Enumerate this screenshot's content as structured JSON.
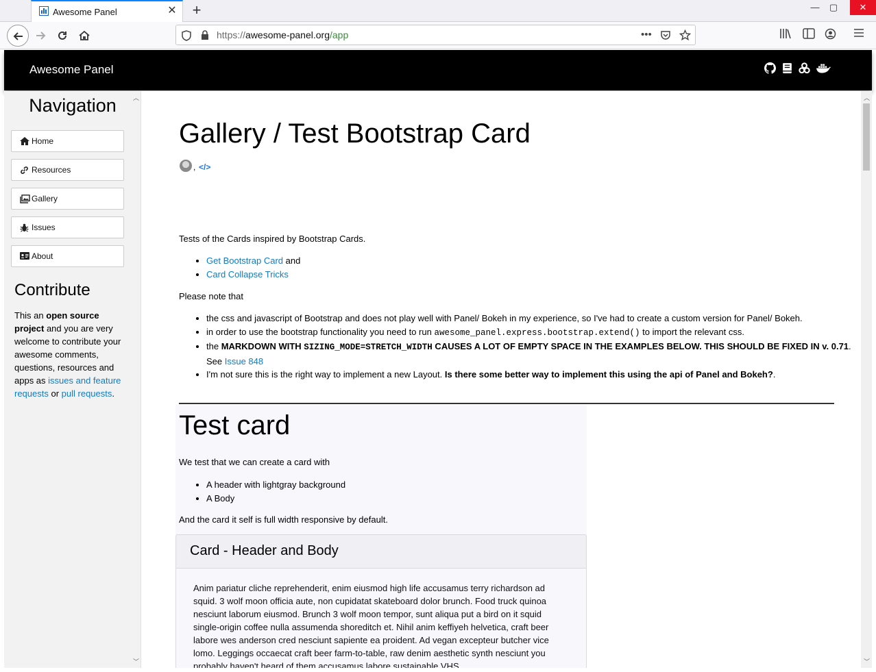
{
  "browser": {
    "tab_title": "Awesome Panel",
    "url_scheme": "https://",
    "url_host": "awesome-panel.org",
    "url_path": "/app"
  },
  "header": {
    "title": "Awesome Panel",
    "icons": [
      "github-icon",
      "book-icon",
      "binder-icon",
      "docker-icon"
    ]
  },
  "sidebar": {
    "heading": "Navigation",
    "items": [
      {
        "label": "Home",
        "icon": "home-icon"
      },
      {
        "label": "Resources",
        "icon": "link-icon"
      },
      {
        "label": "Gallery",
        "icon": "images-icon"
      },
      {
        "label": "Issues",
        "icon": "bug-icon"
      },
      {
        "label": "About",
        "icon": "id-card-icon"
      }
    ],
    "contribute": {
      "heading": "Contribute",
      "t1": "This an ",
      "t2": "open source project",
      "t3": " and you are very welcome to contribute your awesome comments, questions, resources and apps as ",
      "link1": "issues and feature requests",
      "t4": " or ",
      "link2": "pull requests",
      "t5": "."
    }
  },
  "main": {
    "title": "Gallery / Test Bootstrap Card",
    "intro": "Tests of the Cards inspired by Bootstrap Cards.",
    "links": {
      "get_card": "Get Bootstrap Card",
      "and": " and",
      "collapse": "Card Collapse Tricks"
    },
    "note_heading": "Please note that",
    "notes": {
      "n1": "the css and javascript of Bootstrap and does not play well with Panel/ Bokeh in my experience, so I've had to create a custom version for Panel/ Bokeh.",
      "n2a": "in order to use the bootstrap functionality you need to run ",
      "n2code": "awesome_panel.express.bootstrap.extend()",
      "n2b": " to import the relevant css.",
      "n3a": "the ",
      "n3b": "MARKDOWN WITH ",
      "n3code": "SIZING_MODE=STRETCH_WIDTH",
      "n3c": " CAUSES A LOT OF EMPTY SPACE IN THE EXAMPLES BELOW. THIS SHOULD BE FIXED IN v. 0.71",
      "n3d": ". See ",
      "n3link": "Issue 848",
      "n4a": "I'm not sure this is the right way to implement a new Layout. ",
      "n4b": "Is there some better way to implement this using the api of Panel and Bokeh?",
      "n4c": "."
    },
    "card_section": {
      "title": "Test card",
      "intro": "We test that we can create a card with",
      "items": [
        "A header with lightgray background",
        "A Body"
      ],
      "footer": "And the card it self is full width responsive by default."
    },
    "card": {
      "header": "Card - Header and Body",
      "body": "Anim pariatur cliche reprehenderit, enim eiusmod high life accusamus terry richardson ad squid. 3 wolf moon officia aute, non cupidatat skateboard dolor brunch. Food truck quinoa nesciunt laborum eiusmod. Brunch 3 wolf moon tempor, sunt aliqua put a bird on it squid single-origin coffee nulla assumenda shoreditch et. Nihil anim keffiyeh helvetica, craft beer labore wes anderson cred nesciunt sapiente ea proident. Ad vegan excepteur butcher vice lomo. Leggings occaecat craft beer farm-to-table, raw denim aesthetic synth nesciunt you probably haven't heard of them accusamus labore sustainable VHS."
    }
  },
  "colors": {
    "link": "#0f7bc6",
    "header_bg": "#000000",
    "sidebar_bg": "#f2f2f2"
  }
}
